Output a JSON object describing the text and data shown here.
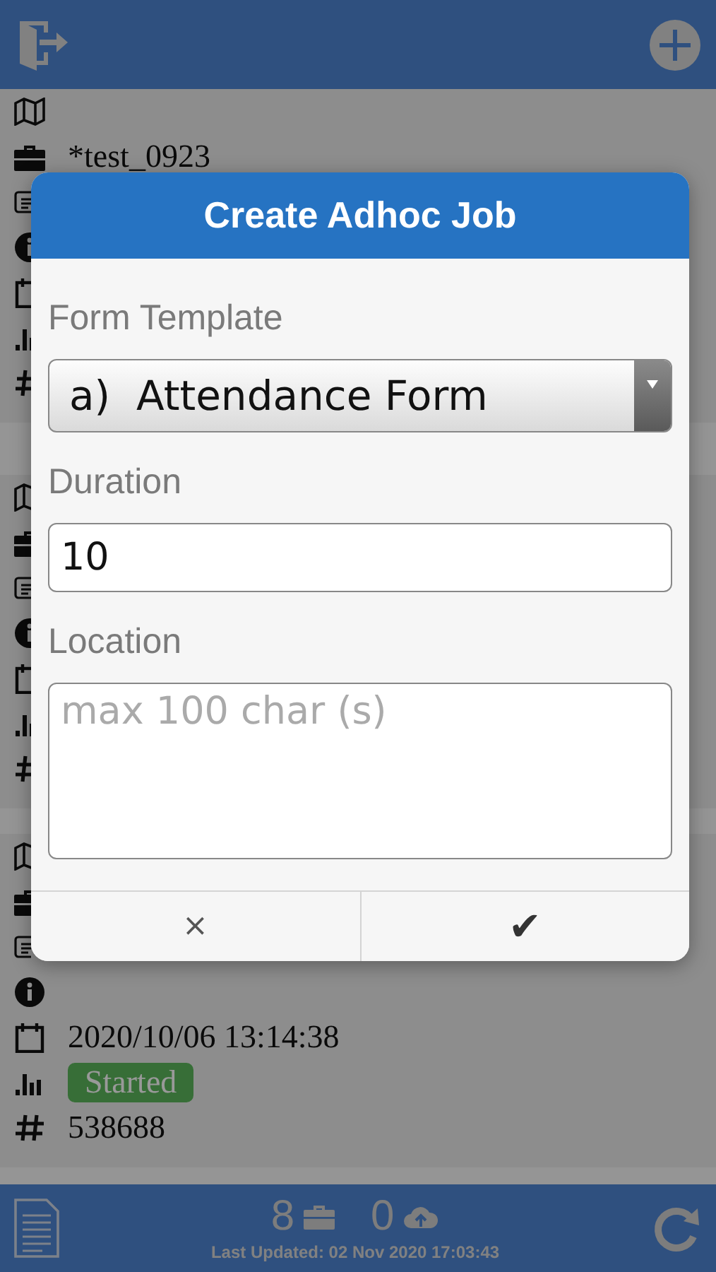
{
  "cards": [
    {
      "rows": [
        {
          "kind": "map"
        },
        {
          "kind": "job",
          "text": "*test_0923"
        },
        {
          "kind": "id"
        },
        {
          "kind": "info"
        },
        {
          "kind": "date"
        },
        {
          "kind": "status"
        },
        {
          "kind": "number"
        }
      ]
    },
    {
      "rows": [
        {
          "kind": "map"
        },
        {
          "kind": "job"
        },
        {
          "kind": "id"
        },
        {
          "kind": "info"
        },
        {
          "kind": "date"
        },
        {
          "kind": "status"
        },
        {
          "kind": "number"
        }
      ]
    },
    {
      "rows": [
        {
          "kind": "map"
        },
        {
          "kind": "job"
        },
        {
          "kind": "id"
        },
        {
          "kind": "info"
        },
        {
          "kind": "date",
          "text": "2020/10/06 13:14:38"
        },
        {
          "kind": "status",
          "text": "Started"
        },
        {
          "kind": "number",
          "text": "538688"
        }
      ]
    }
  ],
  "footer": {
    "job_count": "8",
    "upload_count": "0",
    "last_updated": "Last Updated: 02 Nov 2020 17:03:43"
  },
  "dialog": {
    "title": "Create Adhoc Job",
    "fields": [
      {
        "kind": "select",
        "label": "Form Template",
        "value": "a)  Attendance Form"
      },
      {
        "kind": "text",
        "label": "Duration",
        "value": "10"
      },
      {
        "kind": "textarea",
        "label": "Location",
        "placeholder": "max 100 char (s)"
      }
    ],
    "buttons": [
      {
        "kind": "cancel",
        "text": "×"
      },
      {
        "kind": "confirm",
        "text": "✔"
      }
    ]
  }
}
